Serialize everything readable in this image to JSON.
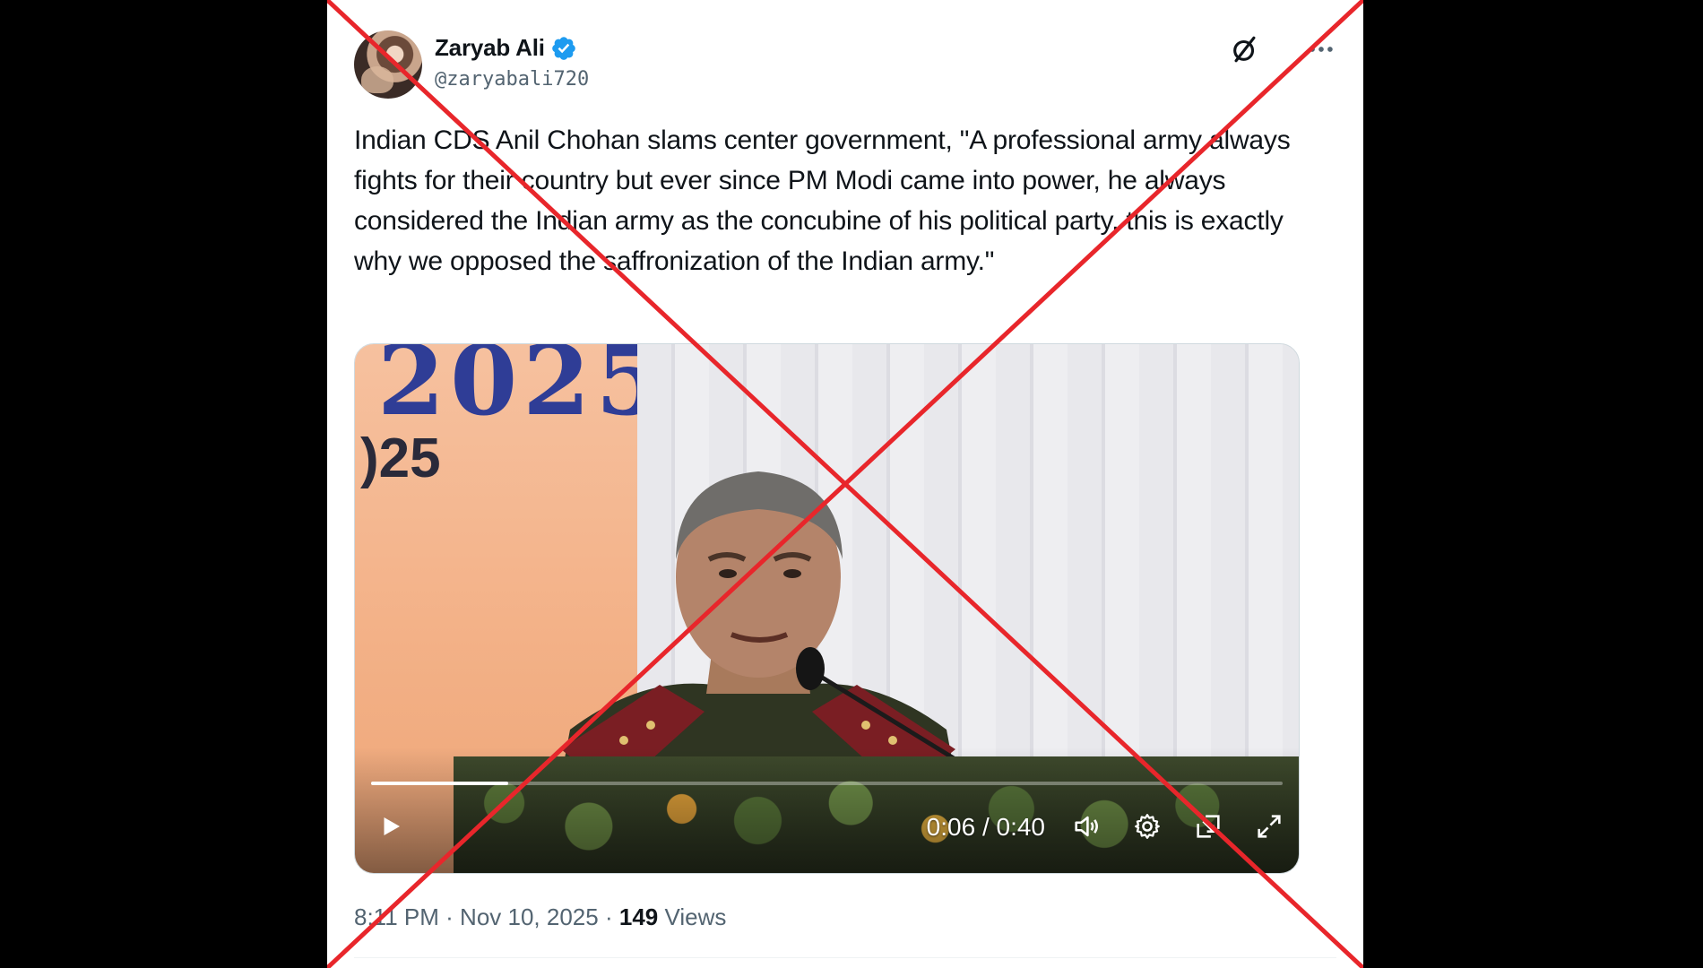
{
  "tweet": {
    "display_name": "Zaryab Ali",
    "handle": "@zaryabali720",
    "text": "Indian CDS Anil Chohan slams center government, \"A professional army always fights for their country but ever since PM Modi came into power, he always considered the Indian army as the concubine of his political party, this is exactly why we opposed the saffronization of the Indian army.\"",
    "time": "8:11 PM",
    "separator": "·",
    "date": "Nov 10, 2025",
    "views_count": "149",
    "views_label": "Views"
  },
  "video": {
    "banner_year": "2025",
    "banner_small": ")25",
    "current_time": "0:06",
    "time_divider": "/",
    "duration": "0:40",
    "progress_fraction": 0.15
  },
  "icons": {
    "verified": "verified-badge-icon",
    "grok": "grok-icon",
    "more": "more-icon",
    "play": "play-icon",
    "volume": "volume-icon",
    "settings": "gear-icon",
    "pip": "picture-in-picture-icon",
    "fullscreen": "fullscreen-icon"
  },
  "colors": {
    "verified_blue": "#1d9bf0",
    "text_primary": "#0f1419",
    "text_secondary": "#536471",
    "cross_red": "#e8262b"
  }
}
